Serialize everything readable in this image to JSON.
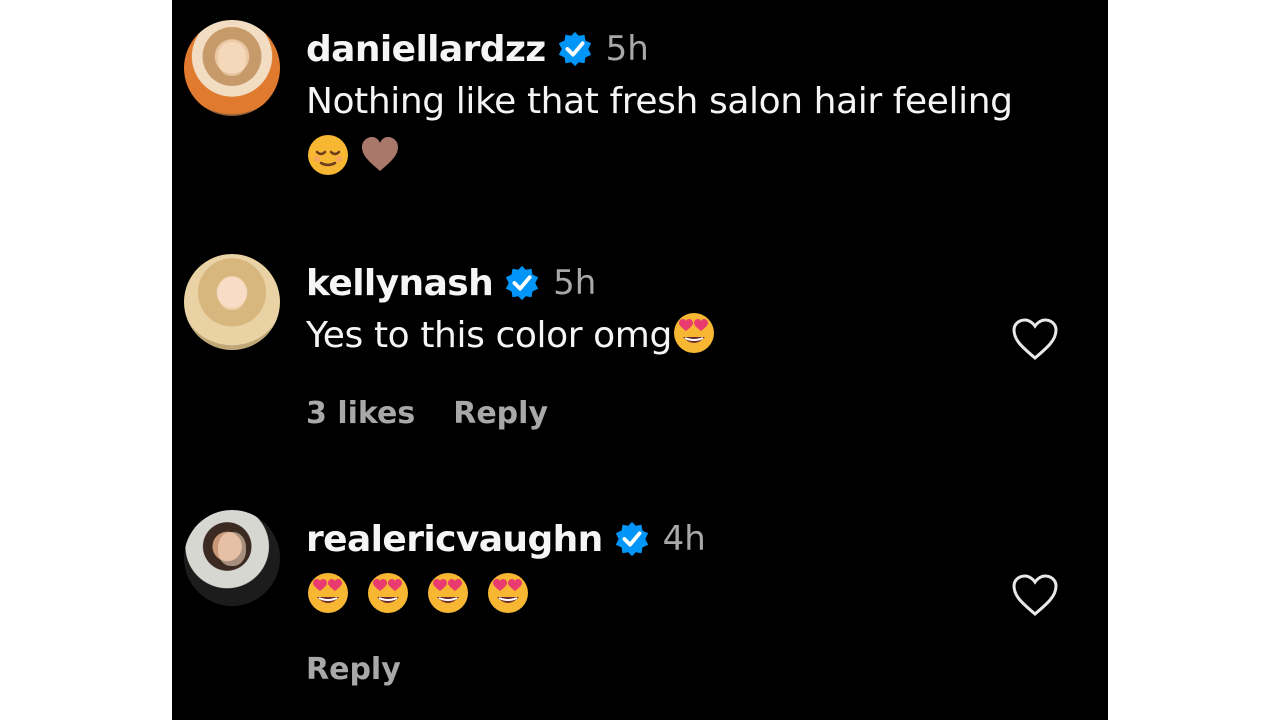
{
  "comments": [
    {
      "username": "daniellardzz",
      "verified": true,
      "time": "5h",
      "text": "Nothing like that fresh salon hair feeling",
      "emojis": [
        "relieved-face",
        "brown-heart"
      ],
      "likes": "",
      "reply": ""
    },
    {
      "username": "kellynash",
      "verified": true,
      "time": "5h",
      "text": "Yes to this color omg",
      "emojis": [
        "heart-eyes-face"
      ],
      "likes": "3 likes",
      "reply": "Reply"
    },
    {
      "username": "realericvaughn",
      "verified": true,
      "time": "4h",
      "text": "",
      "emojis": [
        "heart-eyes-face",
        "heart-eyes-face",
        "heart-eyes-face",
        "heart-eyes-face"
      ],
      "likes": "",
      "reply": "Reply"
    }
  ],
  "colors": {
    "background": "#000000",
    "text_primary": "#f5f5f5",
    "text_secondary": "#a8a8a8",
    "verified_badge": "#0095f6"
  }
}
